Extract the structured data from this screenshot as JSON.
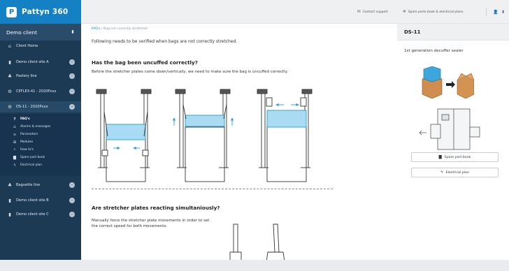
{
  "brand": {
    "name": "Pattyn 360",
    "logo_letter": "P",
    "color": "#1481c4"
  },
  "client_selector": {
    "label": "Demo client",
    "arrow": "⬍"
  },
  "sidebar": {
    "items": [
      {
        "label": "Client Home",
        "icon": "home-icon"
      },
      {
        "label": "Demo client site A",
        "icon": "bar-chart-icon"
      },
      {
        "label": "Pastery line",
        "icon": "shapes-icon"
      },
      {
        "label": "CEFLEX-41 - 2020Pxxx",
        "icon": "gear-icon"
      },
      {
        "label": "DS-11 - 2020Pxxx",
        "icon": "gear-icon"
      },
      {
        "label": "Baguette line",
        "icon": "shapes-icon"
      },
      {
        "label": "Demo client site B",
        "icon": "bar-chart-icon"
      },
      {
        "label": "Demo client site C",
        "icon": "bar-chart-icon"
      }
    ],
    "subitems": [
      {
        "label": "FAQ's",
        "icon": "help-icon"
      },
      {
        "label": "Alarms & messages",
        "icon": "warning-icon"
      },
      {
        "label": "Parameters",
        "icon": "sliders-icon"
      },
      {
        "label": "Modules",
        "icon": "modules-icon"
      },
      {
        "label": "How to's",
        "icon": "search-icon"
      },
      {
        "label": "Spare part book",
        "icon": "book-icon"
      },
      {
        "label": "Electrical plan",
        "icon": "bolt-icon"
      }
    ]
  },
  "topbar": {
    "contact_support": "Contact support",
    "spare_parts": "Spare parts book & electrical plans"
  },
  "content": {
    "breadcrumb_link": "FAQ's",
    "breadcrumb_rest": " / Bag not correctly stretched",
    "intro": "Following needs to be verified when bags are not correctly stretched.",
    "section1_title": "Has the bag been uncuffed correctly?",
    "section1_text": "Before the stretcher plates come down/vertically, we need to make sure the bag is uncuffed correctly.",
    "section2_title": "Are stretcher plates reacting simultaniously?",
    "section2_text": "Manually force the stretcher plate movements in order to set the correct speed for both movements."
  },
  "right_panel": {
    "title": "DS-11",
    "subtitle": "1st generation decuffer sealer",
    "button_spare": "Spare part book",
    "button_electrical": "Electrical plan"
  },
  "colors": {
    "sidebar": "#1d3a55",
    "accent": "#1481c4",
    "bag_blue": "#a9dbf3",
    "arrow_blue": "#2a9ad6"
  }
}
